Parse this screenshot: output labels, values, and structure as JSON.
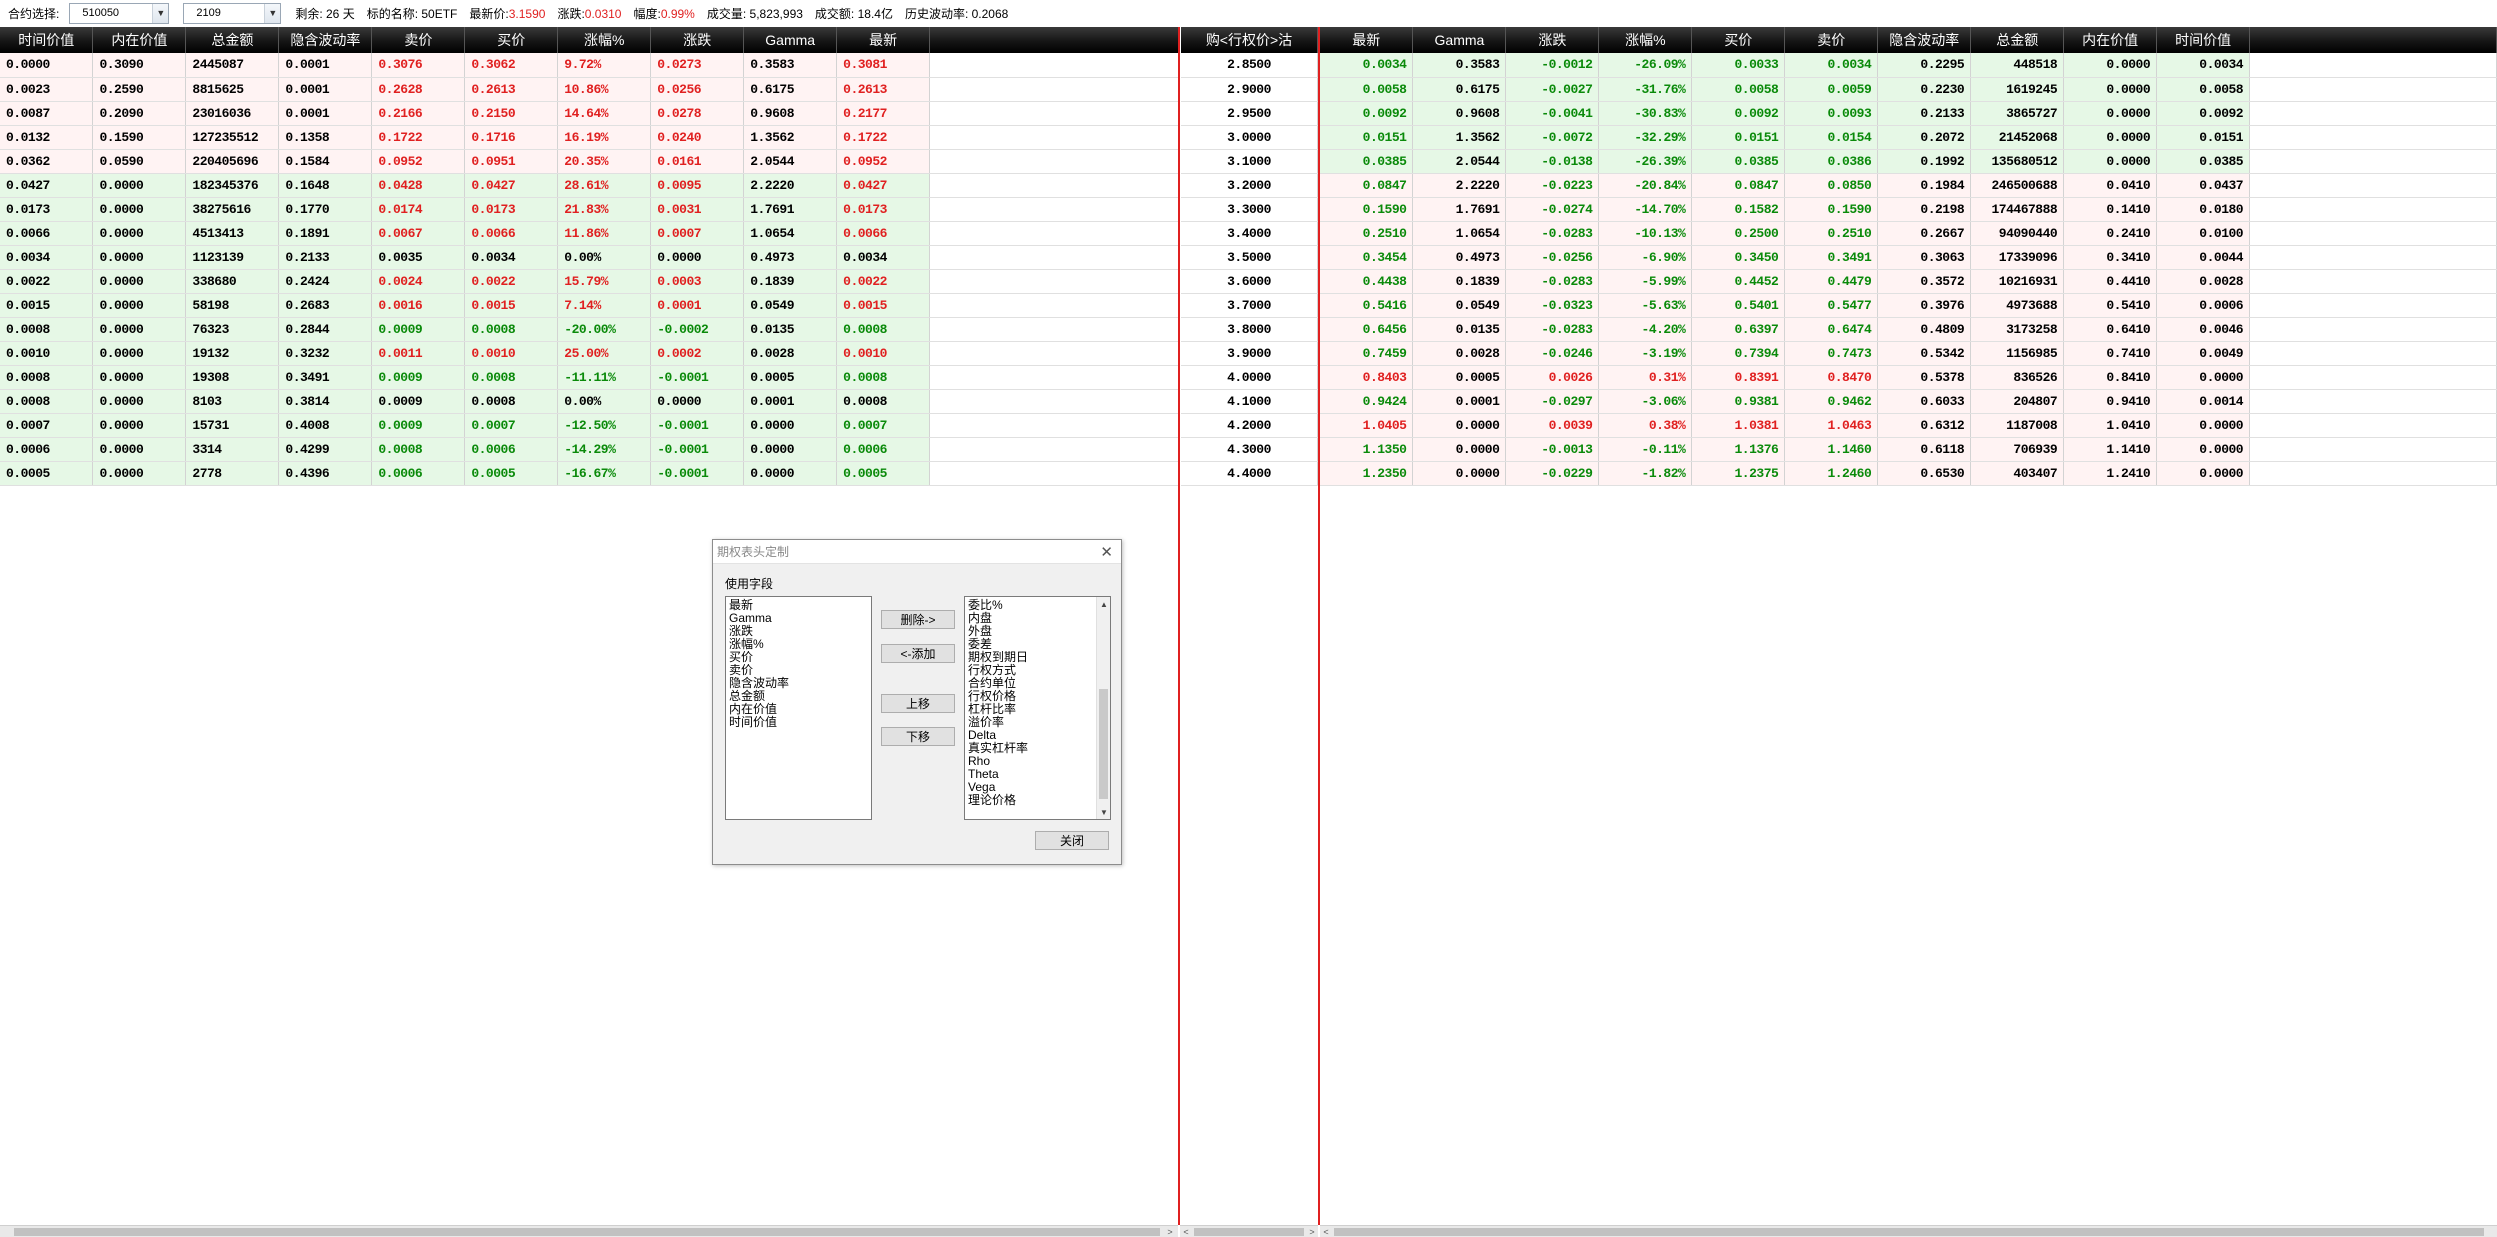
{
  "toolbar": {
    "contract_label": "合约选择:",
    "underlying_code": "510050",
    "month_code": "2109",
    "remaining": "剩余: 26 天",
    "underlying_name": "标的名称: 50ETF",
    "last_price_label": "最新价:",
    "last_price": "3.1590",
    "change_label": "涨跌:",
    "change": "0.0310",
    "range_label": "幅度:",
    "range": "0.99%",
    "volume": "成交量: 5,823,993",
    "turnover": "成交额: 18.4亿",
    "hist_vol": "历史波动率: 0.2068"
  },
  "left_headers": [
    "时间价值",
    "内在价值",
    "总金额",
    "隐含波动率",
    "卖价",
    "买价",
    "涨幅%",
    "涨跌",
    "Gamma",
    "最新"
  ],
  "middle_header": "购<行权价>沽",
  "right_headers": [
    "最新",
    "Gamma",
    "涨跌",
    "涨幅%",
    "买价",
    "卖价",
    "隐含波动率",
    "总金额",
    "内在价值",
    "时间价值"
  ],
  "call_rows": [
    {
      "tv": "0.0000",
      "iv": "0.3090",
      "amt": "2445087",
      "ivol": "0.0001",
      "ask": "0.3076",
      "bid": "0.3062",
      "pct": "9.72%",
      "chg": "0.0273",
      "gamma": "0.3583",
      "last": "0.3081",
      "bg": "pink",
      "dir": "up"
    },
    {
      "tv": "0.0023",
      "iv": "0.2590",
      "amt": "8815625",
      "ivol": "0.0001",
      "ask": "0.2628",
      "bid": "0.2613",
      "pct": "10.86%",
      "chg": "0.0256",
      "gamma": "0.6175",
      "last": "0.2613",
      "bg": "pink",
      "dir": "up"
    },
    {
      "tv": "0.0087",
      "iv": "0.2090",
      "amt": "23016036",
      "ivol": "0.0001",
      "ask": "0.2166",
      "bid": "0.2150",
      "pct": "14.64%",
      "chg": "0.0278",
      "gamma": "0.9608",
      "last": "0.2177",
      "bg": "pink",
      "dir": "up"
    },
    {
      "tv": "0.0132",
      "iv": "0.1590",
      "amt": "127235512",
      "ivol": "0.1358",
      "ask": "0.1722",
      "bid": "0.1716",
      "pct": "16.19%",
      "chg": "0.0240",
      "gamma": "1.3562",
      "last": "0.1722",
      "bg": "pink",
      "dir": "up"
    },
    {
      "tv": "0.0362",
      "iv": "0.0590",
      "amt": "220405696",
      "ivol": "0.1584",
      "ask": "0.0952",
      "bid": "0.0951",
      "pct": "20.35%",
      "chg": "0.0161",
      "gamma": "2.0544",
      "last": "0.0952",
      "bg": "pink",
      "dir": "up"
    },
    {
      "tv": "0.0427",
      "iv": "0.0000",
      "amt": "182345376",
      "ivol": "0.1648",
      "ask": "0.0428",
      "bid": "0.0427",
      "pct": "28.61%",
      "chg": "0.0095",
      "gamma": "2.2220",
      "last": "0.0427",
      "bg": "green",
      "dir": "up"
    },
    {
      "tv": "0.0173",
      "iv": "0.0000",
      "amt": "38275616",
      "ivol": "0.1770",
      "ask": "0.0174",
      "bid": "0.0173",
      "pct": "21.83%",
      "chg": "0.0031",
      "gamma": "1.7691",
      "last": "0.0173",
      "bg": "green",
      "dir": "up"
    },
    {
      "tv": "0.0066",
      "iv": "0.0000",
      "amt": "4513413",
      "ivol": "0.1891",
      "ask": "0.0067",
      "bid": "0.0066",
      "pct": "11.86%",
      "chg": "0.0007",
      "gamma": "1.0654",
      "last": "0.0066",
      "bg": "green",
      "dir": "up"
    },
    {
      "tv": "0.0034",
      "iv": "0.0000",
      "amt": "1123139",
      "ivol": "0.2133",
      "ask": "0.0035",
      "bid": "0.0034",
      "pct": "0.00%",
      "chg": "0.0000",
      "gamma": "0.4973",
      "last": "0.0034",
      "bg": "green",
      "dir": "flat"
    },
    {
      "tv": "0.0022",
      "iv": "0.0000",
      "amt": "338680",
      "ivol": "0.2424",
      "ask": "0.0024",
      "bid": "0.0022",
      "pct": "15.79%",
      "chg": "0.0003",
      "gamma": "0.1839",
      "last": "0.0022",
      "bg": "green",
      "dir": "up"
    },
    {
      "tv": "0.0015",
      "iv": "0.0000",
      "amt": "58198",
      "ivol": "0.2683",
      "ask": "0.0016",
      "bid": "0.0015",
      "pct": "7.14%",
      "chg": "0.0001",
      "gamma": "0.0549",
      "last": "0.0015",
      "bg": "green",
      "dir": "up"
    },
    {
      "tv": "0.0008",
      "iv": "0.0000",
      "amt": "76323",
      "ivol": "0.2844",
      "ask": "0.0009",
      "bid": "0.0008",
      "pct": "-20.00%",
      "chg": "-0.0002",
      "gamma": "0.0135",
      "last": "0.0008",
      "bg": "green",
      "dir": "down"
    },
    {
      "tv": "0.0010",
      "iv": "0.0000",
      "amt": "19132",
      "ivol": "0.3232",
      "ask": "0.0011",
      "bid": "0.0010",
      "pct": "25.00%",
      "chg": "0.0002",
      "gamma": "0.0028",
      "last": "0.0010",
      "bg": "green",
      "dir": "up"
    },
    {
      "tv": "0.0008",
      "iv": "0.0000",
      "amt": "19308",
      "ivol": "0.3491",
      "ask": "0.0009",
      "bid": "0.0008",
      "pct": "-11.11%",
      "chg": "-0.0001",
      "gamma": "0.0005",
      "last": "0.0008",
      "bg": "green",
      "dir": "down"
    },
    {
      "tv": "0.0008",
      "iv": "0.0000",
      "amt": "8103",
      "ivol": "0.3814",
      "ask": "0.0009",
      "bid": "0.0008",
      "pct": "0.00%",
      "chg": "0.0000",
      "gamma": "0.0001",
      "last": "0.0008",
      "bg": "green",
      "dir": "flat"
    },
    {
      "tv": "0.0007",
      "iv": "0.0000",
      "amt": "15731",
      "ivol": "0.4008",
      "ask": "0.0009",
      "bid": "0.0007",
      "pct": "-12.50%",
      "chg": "-0.0001",
      "gamma": "0.0000",
      "last": "0.0007",
      "bg": "green",
      "dir": "down"
    },
    {
      "tv": "0.0006",
      "iv": "0.0000",
      "amt": "3314",
      "ivol": "0.4299",
      "ask": "0.0008",
      "bid": "0.0006",
      "pct": "-14.29%",
      "chg": "-0.0001",
      "gamma": "0.0000",
      "last": "0.0006",
      "bg": "green",
      "dir": "down"
    },
    {
      "tv": "0.0005",
      "iv": "0.0000",
      "amt": "2778",
      "ivol": "0.4396",
      "ask": "0.0006",
      "bid": "0.0005",
      "pct": "-16.67%",
      "chg": "-0.0001",
      "gamma": "0.0000",
      "last": "0.0005",
      "bg": "green",
      "dir": "down"
    }
  ],
  "strikes": [
    "2.8500",
    "2.9000",
    "2.9500",
    "3.0000",
    "3.1000",
    "3.2000",
    "3.3000",
    "3.4000",
    "3.5000",
    "3.6000",
    "3.7000",
    "3.8000",
    "3.9000",
    "4.0000",
    "4.1000",
    "4.2000",
    "4.3000",
    "4.4000"
  ],
  "put_rows": [
    {
      "last": "0.0034",
      "gamma": "0.3583",
      "chg": "-0.0012",
      "pct": "-26.09%",
      "bid": "0.0033",
      "ask": "0.0034",
      "ivol": "0.2295",
      "amt": "448518",
      "iv": "0.0000",
      "tv": "0.0034",
      "bg": "green",
      "dir": "down"
    },
    {
      "last": "0.0058",
      "gamma": "0.6175",
      "chg": "-0.0027",
      "pct": "-31.76%",
      "bid": "0.0058",
      "ask": "0.0059",
      "ivol": "0.2230",
      "amt": "1619245",
      "iv": "0.0000",
      "tv": "0.0058",
      "bg": "green",
      "dir": "down"
    },
    {
      "last": "0.0092",
      "gamma": "0.9608",
      "chg": "-0.0041",
      "pct": "-30.83%",
      "bid": "0.0092",
      "ask": "0.0093",
      "ivol": "0.2133",
      "amt": "3865727",
      "iv": "0.0000",
      "tv": "0.0092",
      "bg": "green",
      "dir": "down"
    },
    {
      "last": "0.0151",
      "gamma": "1.3562",
      "chg": "-0.0072",
      "pct": "-32.29%",
      "bid": "0.0151",
      "ask": "0.0154",
      "ivol": "0.2072",
      "amt": "21452068",
      "iv": "0.0000",
      "tv": "0.0151",
      "bg": "green",
      "dir": "down"
    },
    {
      "last": "0.0385",
      "gamma": "2.0544",
      "chg": "-0.0138",
      "pct": "-26.39%",
      "bid": "0.0385",
      "ask": "0.0386",
      "ivol": "0.1992",
      "amt": "135680512",
      "iv": "0.0000",
      "tv": "0.0385",
      "bg": "green",
      "dir": "down"
    },
    {
      "last": "0.0847",
      "gamma": "2.2220",
      "chg": "-0.0223",
      "pct": "-20.84%",
      "bid": "0.0847",
      "ask": "0.0850",
      "ivol": "0.1984",
      "amt": "246500688",
      "iv": "0.0410",
      "tv": "0.0437",
      "bg": "pink",
      "dir": "down"
    },
    {
      "last": "0.1590",
      "gamma": "1.7691",
      "chg": "-0.0274",
      "pct": "-14.70%",
      "bid": "0.1582",
      "ask": "0.1590",
      "ivol": "0.2198",
      "amt": "174467888",
      "iv": "0.1410",
      "tv": "0.0180",
      "bg": "pink",
      "dir": "down"
    },
    {
      "last": "0.2510",
      "gamma": "1.0654",
      "chg": "-0.0283",
      "pct": "-10.13%",
      "bid": "0.2500",
      "ask": "0.2510",
      "ivol": "0.2667",
      "amt": "94090440",
      "iv": "0.2410",
      "tv": "0.0100",
      "bg": "pink",
      "dir": "down"
    },
    {
      "last": "0.3454",
      "gamma": "0.4973",
      "chg": "-0.0256",
      "pct": "-6.90%",
      "bid": "0.3450",
      "ask": "0.3491",
      "ivol": "0.3063",
      "amt": "17339096",
      "iv": "0.3410",
      "tv": "0.0044",
      "bg": "pink",
      "dir": "down"
    },
    {
      "last": "0.4438",
      "gamma": "0.1839",
      "chg": "-0.0283",
      "pct": "-5.99%",
      "bid": "0.4452",
      "ask": "0.4479",
      "ivol": "0.3572",
      "amt": "10216931",
      "iv": "0.4410",
      "tv": "0.0028",
      "bg": "pink",
      "dir": "down"
    },
    {
      "last": "0.5416",
      "gamma": "0.0549",
      "chg": "-0.0323",
      "pct": "-5.63%",
      "bid": "0.5401",
      "ask": "0.5477",
      "ivol": "0.3976",
      "amt": "4973688",
      "iv": "0.5410",
      "tv": "0.0006",
      "bg": "pink",
      "dir": "down"
    },
    {
      "last": "0.6456",
      "gamma": "0.0135",
      "chg": "-0.0283",
      "pct": "-4.20%",
      "bid": "0.6397",
      "ask": "0.6474",
      "ivol": "0.4809",
      "amt": "3173258",
      "iv": "0.6410",
      "tv": "0.0046",
      "bg": "pink",
      "dir": "down"
    },
    {
      "last": "0.7459",
      "gamma": "0.0028",
      "chg": "-0.0246",
      "pct": "-3.19%",
      "bid": "0.7394",
      "ask": "0.7473",
      "ivol": "0.5342",
      "amt": "1156985",
      "iv": "0.7410",
      "tv": "0.0049",
      "bg": "pink",
      "dir": "down"
    },
    {
      "last": "0.8403",
      "gamma": "0.0005",
      "chg": "0.0026",
      "pct": "0.31%",
      "bid": "0.8391",
      "ask": "0.8470",
      "ivol": "0.5378",
      "amt": "836526",
      "iv": "0.8410",
      "tv": "0.0000",
      "bg": "pink",
      "dir": "up"
    },
    {
      "last": "0.9424",
      "gamma": "0.0001",
      "chg": "-0.0297",
      "pct": "-3.06%",
      "bid": "0.9381",
      "ask": "0.9462",
      "ivol": "0.6033",
      "amt": "204807",
      "iv": "0.9410",
      "tv": "0.0014",
      "bg": "pink",
      "dir": "down"
    },
    {
      "last": "1.0405",
      "gamma": "0.0000",
      "chg": "0.0039",
      "pct": "0.38%",
      "bid": "1.0381",
      "ask": "1.0463",
      "ivol": "0.6312",
      "amt": "1187008",
      "iv": "1.0410",
      "tv": "0.0000",
      "bg": "pink",
      "dir": "up"
    },
    {
      "last": "1.1350",
      "gamma": "0.0000",
      "chg": "-0.0013",
      "pct": "-0.11%",
      "bid": "1.1376",
      "ask": "1.1460",
      "ivol": "0.6118",
      "amt": "706939",
      "iv": "1.1410",
      "tv": "0.0000",
      "bg": "pink",
      "dir": "down"
    },
    {
      "last": "1.2350",
      "gamma": "0.0000",
      "chg": "-0.0229",
      "pct": "-1.82%",
      "bid": "1.2375",
      "ask": "1.2460",
      "ivol": "0.6530",
      "amt": "403407",
      "iv": "1.2410",
      "tv": "0.0000",
      "bg": "pink",
      "dir": "down"
    }
  ],
  "dialog": {
    "title": "期权表头定制",
    "group_label": "使用字段",
    "used_fields": [
      "最新",
      "Gamma",
      "涨跌",
      "涨幅%",
      "买价",
      "卖价",
      "隐含波动率",
      "总金额",
      "内在价值",
      "时间价值"
    ],
    "available_fields": [
      "委比%",
      "内盘",
      "外盘",
      "委差",
      "期权到期日",
      "行权方式",
      "合约单位",
      "行权价格",
      "杠杆比率",
      "溢价率",
      "Delta",
      "真实杠杆率",
      "Rho",
      "Theta",
      "Vega",
      "理论价格"
    ],
    "remove_label": "删除->",
    "add_label": "<-添加",
    "up_label": "上移",
    "down_label": "下移",
    "close_label": "关闭"
  },
  "colors": {
    "up": "#e02020",
    "down": "#0a8a0a",
    "header_bg": "#000000",
    "divider": "#e02020"
  }
}
